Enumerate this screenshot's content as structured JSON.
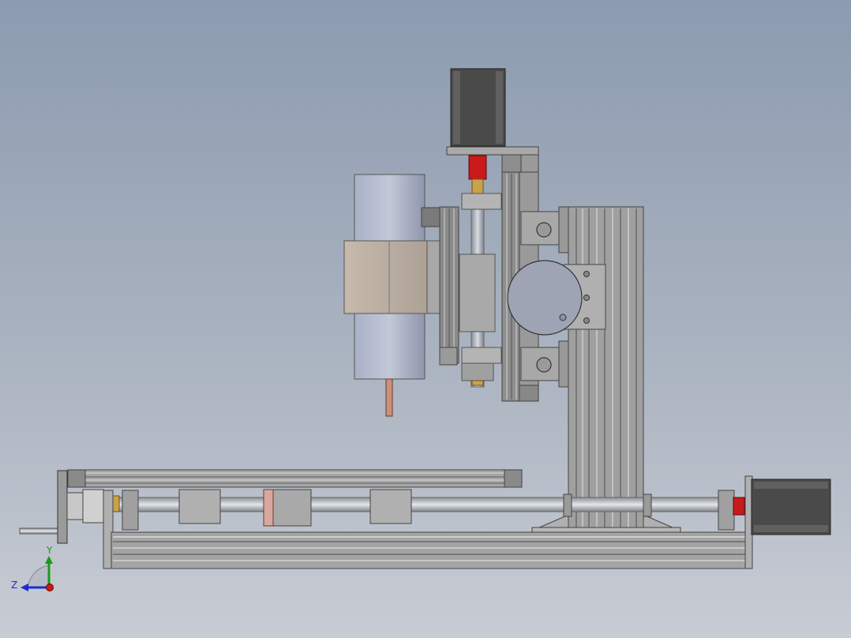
{
  "viewport": {
    "background_top": "#8c9bb0",
    "background_bottom": "#c8ccd4"
  },
  "triad": {
    "y_label": "Y",
    "z_label": "Z",
    "y_color": "#1a9a1a",
    "z_color": "#1a2fd0",
    "x_color": "#d01818"
  },
  "model": {
    "parts": [
      "stepper-motor-z",
      "stepper-motor-x",
      "spindle",
      "column",
      "gantry-plate",
      "lead-screw-z",
      "lead-screw-x",
      "hand-wheel",
      "base-rail",
      "upper-rail"
    ]
  }
}
